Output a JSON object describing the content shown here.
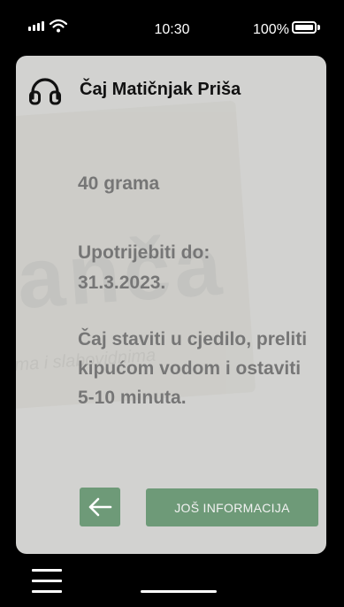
{
  "status_bar": {
    "time": "10:30",
    "battery_percent": "100%"
  },
  "product": {
    "name": "Čaj Matičnjak Priša",
    "weight": "40 grama",
    "use_by_label": "Upotrijebiti do:",
    "use_by_date": "31.3.2023.",
    "instructions": "Čaj staviti u cjedilo, preliti kipućom vodom i ostaviti 5-10 minuta."
  },
  "background_text": {
    "brand": "anča",
    "tagline": "ma i slabovidnima"
  },
  "actions": {
    "back_icon": "arrow-left-icon",
    "more_info_label": "JOŠ INFORMACIJA"
  },
  "nav": {
    "menu_icon": "hamburger-menu-icon"
  },
  "colors": {
    "accent": "#6e9a78",
    "card_background": "#d2d2d0",
    "muted_text": "#767676"
  }
}
